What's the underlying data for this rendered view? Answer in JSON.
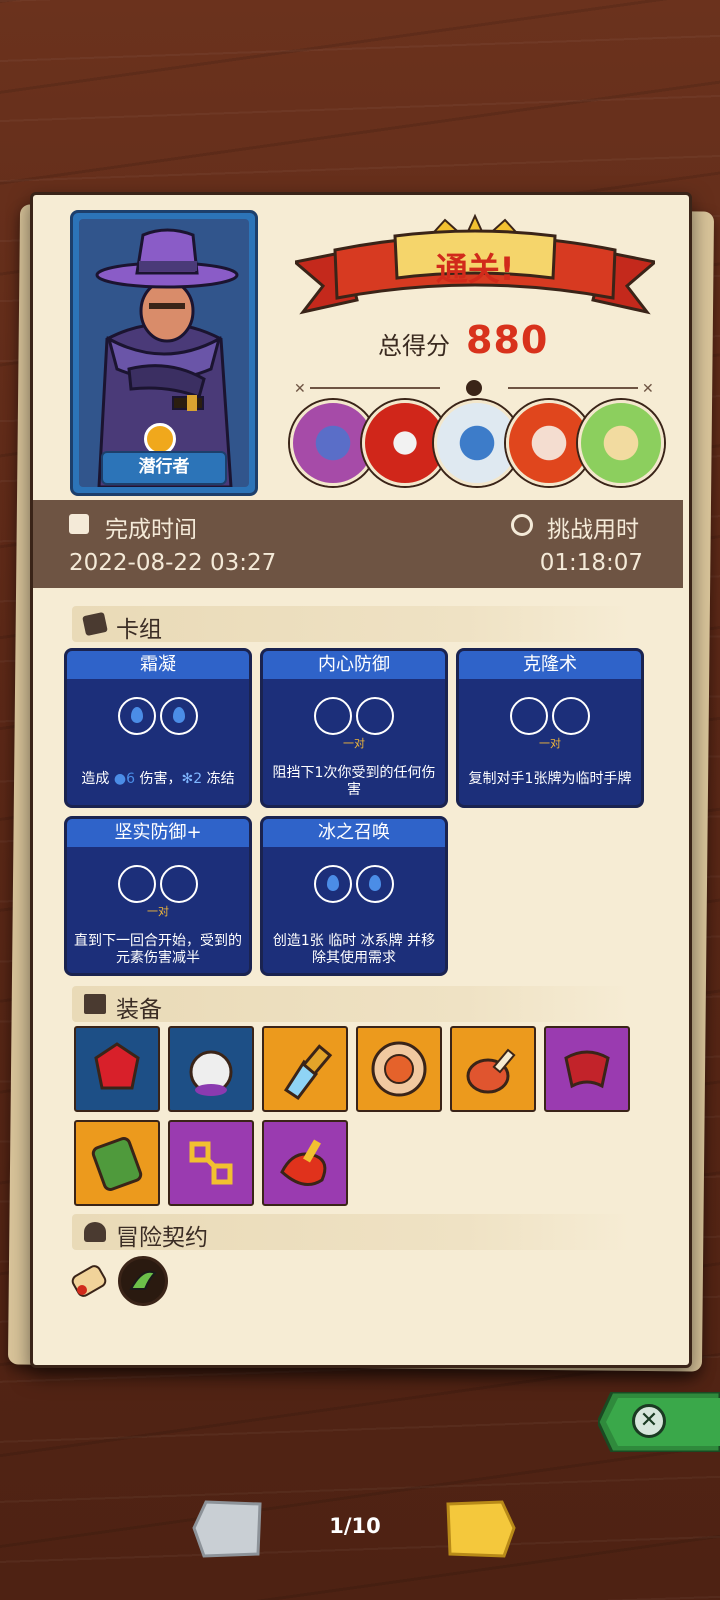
{
  "hero": {
    "name": "潜行者"
  },
  "result": {
    "banner": "通关!",
    "score_label": "总得分",
    "score_value": "880"
  },
  "bosses": [
    "boss-purple-mask",
    "boss-red-cage",
    "boss-ice-beast",
    "boss-flame-face",
    "boss-green-goddess"
  ],
  "time": {
    "complete_label": "完成时间",
    "complete_value": "2022-08-22 03:27",
    "challenge_label": "挑战用时",
    "challenge_value": "01:18:07"
  },
  "sections": {
    "deck": "卡组",
    "equipment": "装备",
    "contract": "冒险契约"
  },
  "cards": [
    {
      "title": "霜凝",
      "pair": "",
      "desc_pre": "造成 ",
      "desc_n1": "6",
      "desc_mid": " 伤害，",
      "desc_n2": "2",
      "desc_post": " 冻结"
    },
    {
      "title": "内心防御",
      "pair": "一对",
      "desc": "阻挡下1次你受到的任何伤害"
    },
    {
      "title": "克隆术",
      "pair": "一对",
      "desc": "复制对手1张牌为临时手牌"
    },
    {
      "title": "坚实防御+",
      "pair": "一对",
      "desc": "直到下一回合开始，受到的元素伤害减半"
    },
    {
      "title": "冰之召唤",
      "pair": "",
      "desc": "创造1张 临时 冰系牌 并移除其使用需求"
    }
  ],
  "equipment": [
    {
      "icon": "ruby-gem-icon",
      "color": "#1d4f86"
    },
    {
      "icon": "skull-helmet-icon",
      "color": "#1d4f86"
    },
    {
      "icon": "crystal-dagger-icon",
      "color": "#ec9a1d"
    },
    {
      "icon": "round-shield-icon",
      "color": "#ec9a1d"
    },
    {
      "icon": "meat-leg-icon",
      "color": "#ec9a1d"
    },
    {
      "icon": "fang-bracer-icon",
      "color": "#9a3bb0"
    },
    {
      "icon": "moss-tablet-icon",
      "color": "#ec9a1d"
    },
    {
      "icon": "gold-chain-icon",
      "color": "#9a3bb0"
    },
    {
      "icon": "red-scroll-icon",
      "color": "#9a3bb0"
    }
  ],
  "contracts": [
    "scroll-contract-icon",
    "green-claw-icon"
  ],
  "pager": {
    "indicator": "1/10"
  }
}
